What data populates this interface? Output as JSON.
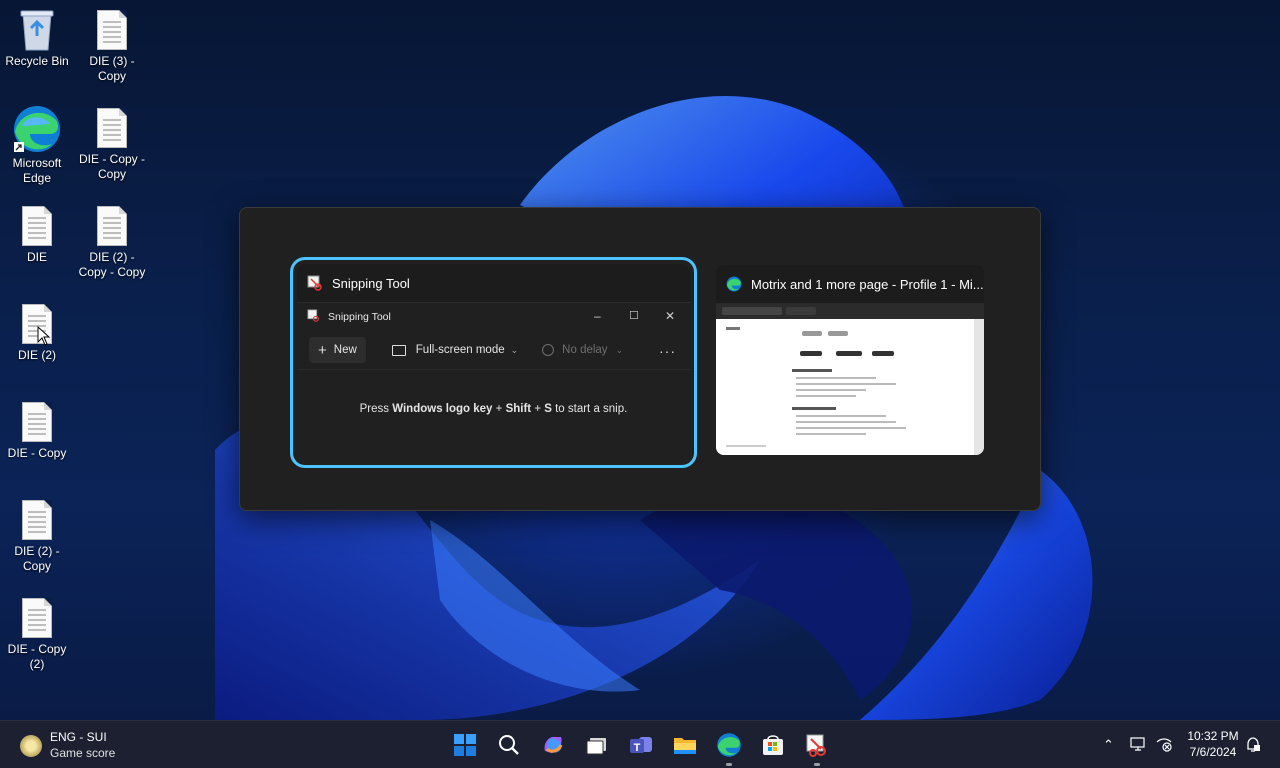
{
  "desktop": {
    "icons": [
      {
        "label": "Recycle Bin",
        "icon": "recycle-bin-icon"
      },
      {
        "label": "DIE (3) - Copy",
        "icon": "document-icon"
      },
      {
        "label": "Microsoft Edge",
        "icon": "edge-icon"
      },
      {
        "label": "DIE - Copy - Copy",
        "icon": "document-icon"
      },
      {
        "label": "DIE",
        "icon": "document-icon"
      },
      {
        "label": "DIE (2) - Copy - Copy",
        "icon": "document-icon"
      },
      {
        "label": "DIE (2)",
        "icon": "document-icon"
      },
      {
        "label": "DIE - Copy",
        "icon": "document-icon"
      },
      {
        "label": "DIE (2) - Copy",
        "icon": "document-icon"
      },
      {
        "label": "DIE - Copy (2)",
        "icon": "document-icon"
      }
    ]
  },
  "task_switcher": {
    "windows": [
      {
        "title": "Snipping Tool",
        "selected": true,
        "inner": {
          "title": "Snipping Tool",
          "minimize": "–",
          "maximize": "☐",
          "close": "✕",
          "new_label": "New",
          "new_icon": "+",
          "mode_label": "Full-screen mode",
          "delay_label": "No delay",
          "more": "···",
          "message_prefix": "Press ",
          "message_bold1": "Windows logo key",
          "message_mid1": " + ",
          "message_bold2": "Shift",
          "message_mid2": " + ",
          "message_bold3": "S",
          "message_suffix": " to start a snip."
        }
      },
      {
        "title": "Motrix and 1 more page - Profile 1 - Mi...",
        "selected": false
      }
    ]
  },
  "taskbar": {
    "widget": {
      "line1": "ENG - SUI",
      "line2": "Game score"
    },
    "apps": [
      "start-icon",
      "search-icon",
      "copilot-icon",
      "task-view-icon",
      "teams-icon",
      "file-explorer-icon",
      "edge-icon",
      "store-icon",
      "snipping-tool-icon"
    ],
    "clock": {
      "time": "10:32 PM",
      "date": "7/6/2024"
    },
    "tray_icons": [
      "chevron-up-icon",
      "display-icon",
      "network-icon",
      "notification-icon"
    ]
  },
  "colors": {
    "accent": "#4cc2ff",
    "switcher_bg": "#202020",
    "taskbar_bg": "#1c2030"
  }
}
